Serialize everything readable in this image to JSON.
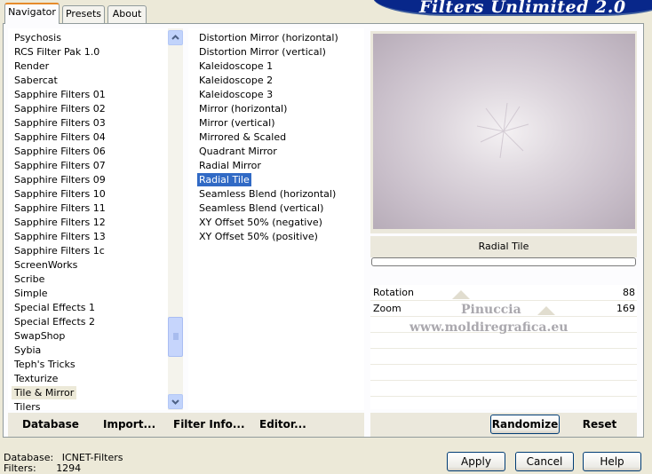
{
  "tabs": [
    {
      "label": "Navigator",
      "active": true
    },
    {
      "label": "Presets",
      "active": false
    },
    {
      "label": "About",
      "active": false
    }
  ],
  "banner": {
    "title": "Filters Unlimited 2.0"
  },
  "categories": {
    "items": [
      "Psychosis",
      "RCS Filter Pak 1.0",
      "Render",
      "Sabercat",
      "Sapphire Filters 01",
      "Sapphire Filters 02",
      "Sapphire Filters 03",
      "Sapphire Filters 04",
      "Sapphire Filters 06",
      "Sapphire Filters 07",
      "Sapphire Filters 09",
      "Sapphire Filters 10",
      "Sapphire Filters 11",
      "Sapphire Filters 12",
      "Sapphire Filters 13",
      "Sapphire Filters 1c",
      "ScreenWorks",
      "Scribe",
      "Simple",
      "Special Effects 1",
      "Special Effects 2",
      "SwapShop",
      "Sybia",
      "Teph's Tricks",
      "Texturize",
      "Tile & Mirror",
      "Tilers"
    ],
    "selected": "Tile & Mirror"
  },
  "filters": {
    "items": [
      "Distortion Mirror (horizontal)",
      "Distortion Mirror (vertical)",
      "Kaleidoscope 1",
      "Kaleidoscope 2",
      "Kaleidoscope 3",
      "Mirror (horizontal)",
      "Mirror (vertical)",
      "Mirrored & Scaled",
      "Quadrant Mirror",
      "Radial Mirror",
      "Radial Tile",
      "Seamless Blend (horizontal)",
      "Seamless Blend (vertical)",
      "XY Offset 50% (negative)",
      "XY Offset 50% (positive)"
    ],
    "selected": "Radial Tile"
  },
  "preview": {
    "filter_name": "Radial Tile"
  },
  "params": [
    {
      "label": "Rotation",
      "value": "88"
    },
    {
      "label": "Zoom",
      "value": "169"
    }
  ],
  "watermark": {
    "line1": "Pinuccia",
    "line2": "www.moldiregrafica.eu"
  },
  "bottom_buttons": {
    "database": "Database",
    "import": "Import...",
    "filter_info": "Filter Info...",
    "editor": "Editor...",
    "randomize": "Randomize",
    "reset": "Reset"
  },
  "dialog_buttons": {
    "apply": "Apply",
    "cancel": "Cancel",
    "help": "Help"
  },
  "status": {
    "database_label": "Database:",
    "database_value": "ICNET-Filters",
    "filters_label": "Filters:",
    "filters_value": "1294"
  },
  "colors": {
    "banner": "#08278a",
    "selection": "#316ac5",
    "tab_accent": "#e68b2c"
  }
}
